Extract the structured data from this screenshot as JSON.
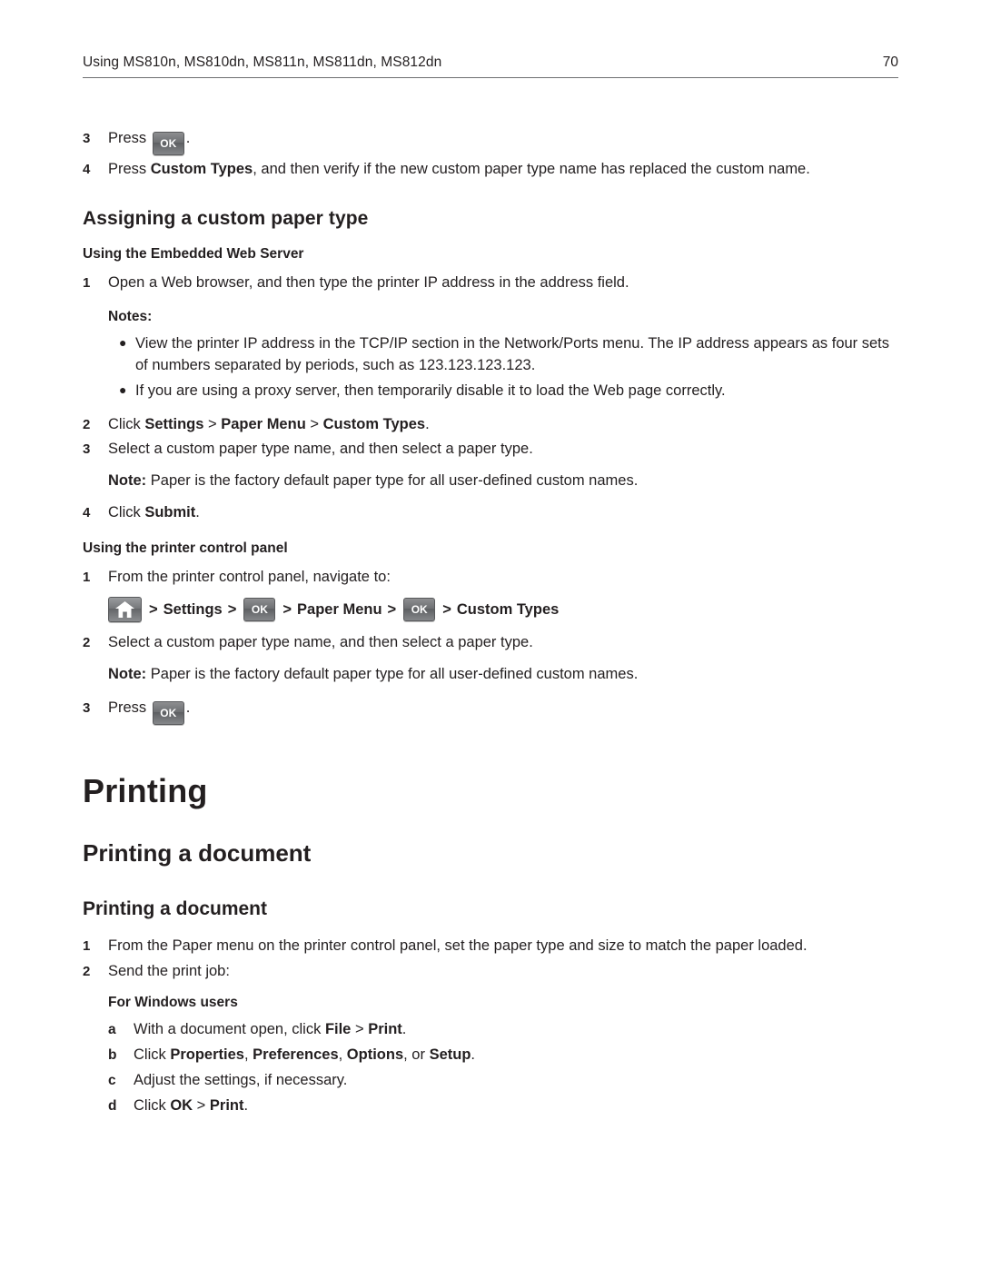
{
  "header": {
    "title": "Using MS810n, MS810dn, MS811n, MS811dn, MS812dn",
    "page_number": "70"
  },
  "keys": {
    "ok_label": "OK",
    "home_icon": "home-icon"
  },
  "top_steps": [
    {
      "num": "3",
      "pre": "Press",
      "key": "ok",
      "post": "."
    },
    {
      "num": "4",
      "text_before": "Press ",
      "bold": "Custom Types",
      "text_after": ", and then verify if the new custom paper type name has replaced the custom name."
    }
  ],
  "section": {
    "title": "Assigning a custom paper type",
    "sub1_title": "Using the Embedded Web Server",
    "step1": {
      "num": "1",
      "text": "Open a Web browser, and then type the printer IP address in the address field."
    },
    "notes_label": "Notes:",
    "notes": [
      "View the printer IP address in the TCP/IP section in the Network/Ports menu. The IP address appears as four sets of numbers separated by periods, such as 123.123.123.123.",
      "If you are using a proxy server, then temporarily disable it to load the Web page correctly."
    ],
    "step2": {
      "num": "2",
      "prefix": "Click ",
      "bold1": "Settings",
      "sep1": " > ",
      "bold2": "Paper Menu",
      "sep2": " > ",
      "bold3": "Custom Types",
      "suffix": "."
    },
    "step3": {
      "num": "3",
      "text": "Select a custom paper type name, and then select a paper type."
    },
    "note3": {
      "label": "Note:",
      "text": " Paper is the factory default paper type for all user‑defined custom names."
    },
    "step4": {
      "num": "4",
      "prefix": "Click ",
      "bold": "Submit",
      "suffix": "."
    },
    "sub2_title": "Using the printer control panel",
    "p_step1": {
      "num": "1",
      "text": "From the printer control panel, navigate to:"
    },
    "nav": {
      "sep": ">",
      "settings": "Settings",
      "paper_menu": "Paper Menu",
      "custom_types": "Custom Types"
    },
    "p_step2": {
      "num": "2",
      "text": "Select a custom paper type name, and then select a paper type."
    },
    "p_note": {
      "label": "Note:",
      "text": " Paper is the factory default paper type for all user‑defined custom names."
    },
    "p_step3": {
      "num": "3",
      "pre": "Press",
      "post": "."
    }
  },
  "chapter": {
    "title": "Printing",
    "section_title": "Printing a document",
    "subsection_title": "Printing a document",
    "step1": {
      "num": "1",
      "text": "From the Paper menu on the printer control panel, set the paper type and size to match the paper loaded."
    },
    "step2": {
      "num": "2",
      "text": "Send the print job:"
    },
    "windows_label": "For Windows users",
    "sub_a": {
      "num": "a",
      "prefix": "With a document open, click ",
      "bold1": "File",
      "sep": " > ",
      "bold2": "Print",
      "suffix": "."
    },
    "sub_b": {
      "num": "b",
      "prefix": "Click ",
      "bold1": "Properties",
      "c1": ", ",
      "bold2": "Preferences",
      "c2": ", ",
      "bold3": "Options",
      "c3": ", or ",
      "bold4": "Setup",
      "suffix": "."
    },
    "sub_c": {
      "num": "c",
      "text": "Adjust the settings, if necessary."
    },
    "sub_d": {
      "num": "d",
      "prefix": "Click ",
      "bold1": "OK",
      "sep": " > ",
      "bold2": "Print",
      "suffix": "."
    }
  }
}
